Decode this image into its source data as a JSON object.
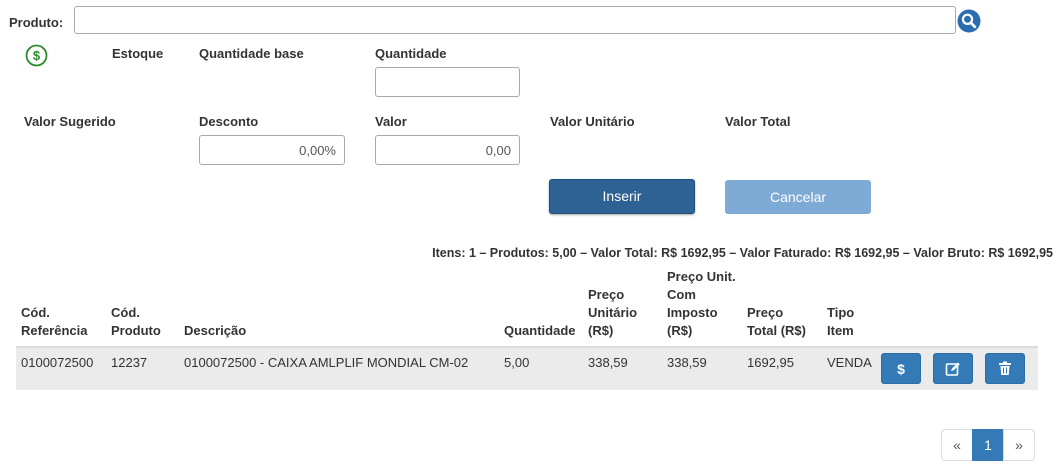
{
  "product": {
    "label": "Produto:",
    "value": "",
    "search_icon": "search-icon"
  },
  "price_icon": "dollar-circle-icon",
  "fields": {
    "estoque_label": "Estoque",
    "quantidade_base_label": "Quantidade base",
    "quantidade_label": "Quantidade",
    "quantidade_value": "",
    "valor_sugerido_label": "Valor Sugerido",
    "desconto_label": "Desconto",
    "desconto_value": "0,00%",
    "valor_label": "Valor",
    "valor_value": "0,00",
    "valor_unitario_label": "Valor Unitário",
    "valor_total_label": "Valor Total"
  },
  "buttons": {
    "inserir": "Inserir",
    "cancelar": "Cancelar"
  },
  "summary": "Itens: 1 – Produtos: 5,00 – Valor Total: R$ 1692,95 – Valor Faturado: R$ 1692,95 – Valor Bruto: R$ 1692,95",
  "table": {
    "headers": {
      "cod_ref_1": "Cód.",
      "cod_ref_2": "Referência",
      "cod_prod_1": "Cód.",
      "cod_prod_2": "Produto",
      "descricao": "Descrição",
      "quantidade": "Quantidade",
      "preco_unit_1": "Preço",
      "preco_unit_2": "Unitário",
      "preco_unit_3": "(R$)",
      "preco_imp_1": "Preço Unit.",
      "preco_imp_2": "Com",
      "preco_imp_3": "Imposto",
      "preco_imp_4": "(R$)",
      "preco_total_1": "Preço",
      "preco_total_2": "Total (R$)",
      "tipo_1": "Tipo",
      "tipo_2": "Item"
    },
    "rows": [
      {
        "cod_referencia": "0100072500",
        "cod_produto": "12237",
        "descricao": "0100072500 - CAIXA AMLPLIF MONDIAL CM-02",
        "quantidade": "5,00",
        "preco_unitario": "338,59",
        "preco_com_imposto": "338,59",
        "preco_total": "1692,95",
        "tipo_item": "VENDA",
        "actions": [
          "dollar-icon",
          "edit-icon",
          "trash-icon"
        ]
      }
    ]
  },
  "pagination": {
    "prev": "«",
    "current": "1",
    "next": "»"
  },
  "colors": {
    "primary": "#2e6294",
    "disabled": "#7eaad6",
    "action": "#337ab7",
    "price_icon": "#2d8a2d"
  }
}
